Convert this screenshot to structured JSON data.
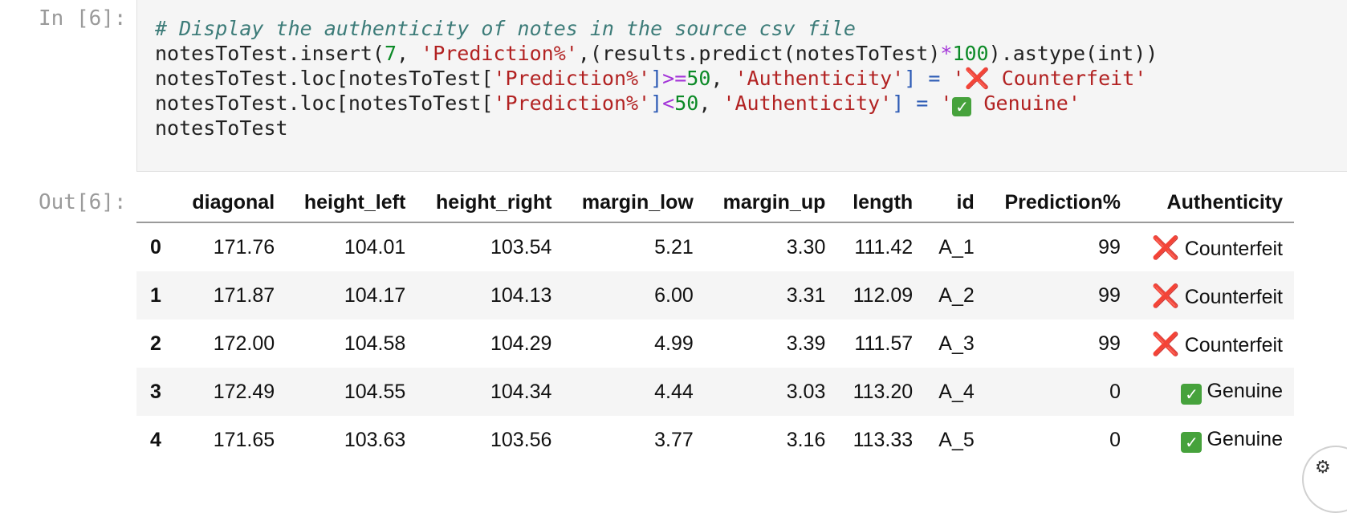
{
  "cell_in": {
    "prompt": "In [6]:",
    "comment": "# Display the authenticity of notes in the source csv file",
    "line2": {
      "a": "notesToTest.insert(",
      "n7": "7",
      "b": ", ",
      "s1": "'Prediction%'",
      "c": ",(results.predict(notesToTest)",
      "op": "*",
      "n100": "100",
      "d": ").astype(int))"
    },
    "line3": {
      "a": "notesToTest.loc[notesToTest[",
      "s1": "'Prediction%'",
      "b": "]",
      "op": ">=",
      "n": "50",
      "c": ", ",
      "s2": "'Authenticity'",
      "d": "] = ",
      "s3a": "'",
      "emoji": "❌",
      "s3b": " Counterfeit'"
    },
    "line4": {
      "a": "notesToTest.loc[notesToTest[",
      "s1": "'Prediction%'",
      "b": "]",
      "op": "<",
      "n": "50",
      "c": ", ",
      "s2": "'Authenticity'",
      "d": "] = ",
      "s3a": "'",
      "emoji": "✓",
      "s3b": " Genuine'"
    },
    "line5": "notesToTest"
  },
  "cell_out": {
    "prompt": "Out[6]:",
    "columns": [
      "",
      "diagonal",
      "height_left",
      "height_right",
      "margin_low",
      "margin_up",
      "length",
      "id",
      "Prediction%",
      "Authenticity"
    ],
    "rows": [
      {
        "index": "0",
        "diagonal": "171.76",
        "height_left": "104.01",
        "height_right": "103.54",
        "margin_low": "5.21",
        "margin_up": "3.30",
        "length": "111.42",
        "id": "A_1",
        "prediction": "99",
        "authenticity": "Counterfeit",
        "auth_icon": "❌"
      },
      {
        "index": "1",
        "diagonal": "171.87",
        "height_left": "104.17",
        "height_right": "104.13",
        "margin_low": "6.00",
        "margin_up": "3.31",
        "length": "112.09",
        "id": "A_2",
        "prediction": "99",
        "authenticity": "Counterfeit",
        "auth_icon": "❌"
      },
      {
        "index": "2",
        "diagonal": "172.00",
        "height_left": "104.58",
        "height_right": "104.29",
        "margin_low": "4.99",
        "margin_up": "3.39",
        "length": "111.57",
        "id": "A_3",
        "prediction": "99",
        "authenticity": "Counterfeit",
        "auth_icon": "❌"
      },
      {
        "index": "3",
        "diagonal": "172.49",
        "height_left": "104.55",
        "height_right": "104.34",
        "margin_low": "4.44",
        "margin_up": "3.03",
        "length": "113.20",
        "id": "A_4",
        "prediction": "0",
        "authenticity": "Genuine",
        "auth_icon": "✓"
      },
      {
        "index": "4",
        "diagonal": "171.65",
        "height_left": "103.63",
        "height_right": "103.56",
        "margin_low": "3.77",
        "margin_up": "3.16",
        "length": "113.33",
        "id": "A_5",
        "prediction": "0",
        "authenticity": "Genuine",
        "auth_icon": "✓"
      }
    ]
  },
  "icons": {
    "counterfeit": "cross-mark-icon",
    "genuine": "check-mark-icon",
    "corner": "settings-icon"
  },
  "colors": {
    "counterfeit": "#e03a2f",
    "genuine": "#46a23c",
    "code_bg": "#f5f5f5"
  }
}
